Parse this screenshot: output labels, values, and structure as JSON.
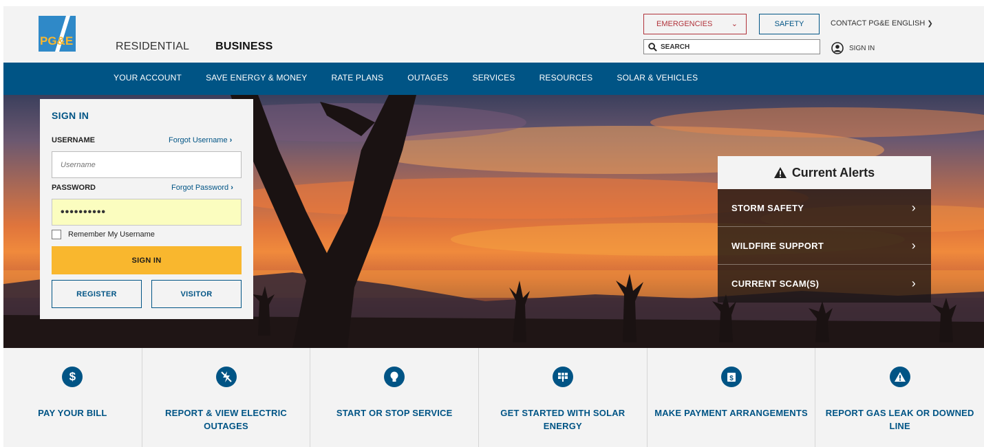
{
  "brand": {
    "logo_text": "PG&E",
    "colors": {
      "navy": "#005485",
      "gold": "#f9b72e",
      "red": "#b0323a"
    }
  },
  "header": {
    "tabs": [
      "RESIDENTIAL",
      "BUSINESS"
    ],
    "active_tab": "BUSINESS",
    "emergencies_label": "EMERGENCIES",
    "safety_label": "SAFETY",
    "contact_label": "CONTACT PG&E",
    "language_label": "ENGLISH",
    "search_placeholder": "SEARCH",
    "signin_label": "SIGN IN"
  },
  "mainnav": [
    "YOUR ACCOUNT",
    "SAVE ENERGY & MONEY",
    "RATE PLANS",
    "OUTAGES",
    "SERVICES",
    "RESOURCES",
    "SOLAR & VEHICLES"
  ],
  "signin": {
    "title": "SIGN IN",
    "username_label": "USERNAME",
    "forgot_username": "Forgot Username",
    "username_placeholder": "Username",
    "password_label": "PASSWORD",
    "forgot_password": "Forgot Password",
    "password_value": "••••••••••",
    "remember_label": "Remember My Username",
    "signin_button": "SIGN IN",
    "register_button": "REGISTER",
    "visitor_button": "VISITOR"
  },
  "alerts": {
    "title": "Current Alerts",
    "items": [
      "STORM SAFETY",
      "WILDFIRE SUPPORT",
      "CURRENT SCAM(S)"
    ]
  },
  "quick_links": [
    {
      "label": "PAY YOUR BILL",
      "icon": "dollar-icon"
    },
    {
      "label": "REPORT & VIEW ELECTRIC OUTAGES",
      "icon": "power-outage-icon"
    },
    {
      "label": "START OR STOP SERVICE",
      "icon": "lightbulb-icon"
    },
    {
      "label": "GET STARTED WITH SOLAR ENERGY",
      "icon": "solar-panel-icon"
    },
    {
      "label": "MAKE PAYMENT ARRANGEMENTS",
      "icon": "payment-calendar-icon"
    },
    {
      "label": "REPORT GAS LEAK OR DOWNED LINE",
      "icon": "warning-icon"
    }
  ]
}
